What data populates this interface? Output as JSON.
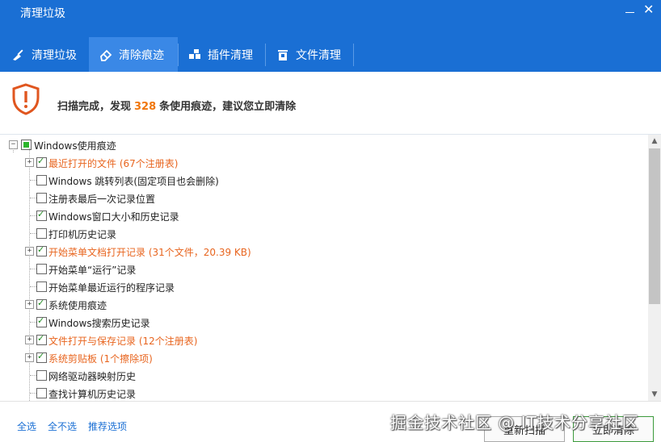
{
  "window": {
    "title": "清理垃圾"
  },
  "tabs": [
    {
      "label": "清理垃圾",
      "icon": "broom-icon"
    },
    {
      "label": "清除痕迹",
      "icon": "eraser-icon"
    },
    {
      "label": "插件清理",
      "icon": "puzzle-icon"
    },
    {
      "label": "文件清理",
      "icon": "trash-icon"
    }
  ],
  "banner": {
    "prefix": "扫描完成，发现",
    "count": "328",
    "suffix": "条使用痕迹，建议您立即清除"
  },
  "tree": {
    "root": "Windows使用痕迹",
    "items": [
      {
        "label": "最近打开的文件 (67个注册表)",
        "checked": true,
        "expandable": true,
        "orange": true
      },
      {
        "label": "Windows 跳转列表(固定项目也会删除)",
        "checked": false,
        "expandable": false,
        "orange": false
      },
      {
        "label": "注册表最后一次记录位置",
        "checked": false,
        "expandable": false,
        "orange": false
      },
      {
        "label": "Windows窗口大小和历史记录",
        "checked": true,
        "expandable": false,
        "orange": false
      },
      {
        "label": "打印机历史记录",
        "checked": false,
        "expandable": false,
        "orange": false
      },
      {
        "label": "开始菜单文档打开记录 (31个文件，20.39 KB)",
        "checked": true,
        "expandable": true,
        "orange": true
      },
      {
        "label": "开始菜单“运行”记录",
        "checked": false,
        "expandable": false,
        "orange": false
      },
      {
        "label": "开始菜单最近运行的程序记录",
        "checked": false,
        "expandable": false,
        "orange": false
      },
      {
        "label": "系统使用痕迹",
        "checked": true,
        "expandable": true,
        "orange": false
      },
      {
        "label": "Windows搜索历史记录",
        "checked": true,
        "expandable": false,
        "orange": false
      },
      {
        "label": "文件打开与保存记录 (12个注册表)",
        "checked": true,
        "expandable": true,
        "orange": true
      },
      {
        "label": "系统剪贴板 (1个擦除项)",
        "checked": true,
        "expandable": true,
        "orange": true
      },
      {
        "label": "网络驱动器映射历史",
        "checked": false,
        "expandable": false,
        "orange": false
      },
      {
        "label": "查找计算机历史记录",
        "checked": false,
        "expandable": false,
        "orange": false
      }
    ]
  },
  "footer": {
    "select_all": "全选",
    "select_none": "全不选",
    "recommended": "推荐选项",
    "rescan": "重新扫描",
    "clean_now": "立即清除"
  },
  "watermark": "掘金技术社区 @ IT技术分享社区",
  "colors": {
    "titlebar": "#1a6fd4",
    "active_tab": "#3a88e6",
    "accent_orange": "#f0760b",
    "warning_red": "#e0561f"
  }
}
